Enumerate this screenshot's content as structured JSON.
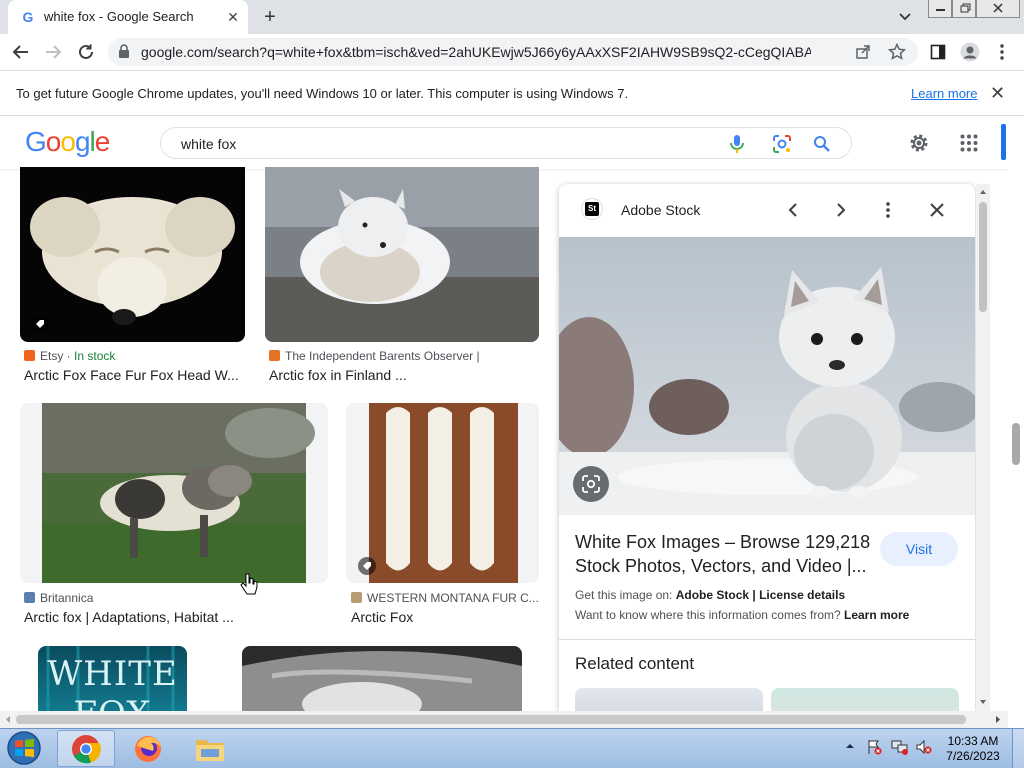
{
  "browser": {
    "tab_title": "white fox - Google Search",
    "new_tab_label": "+",
    "url": "google.com/search?q=white+fox&tbm=isch&ved=2ahUKEwjw5J66y6yAAxXSF2IAHW9SB9sQ2-cCegQIABAA&o..."
  },
  "infobar": {
    "message": "To get future Google Chrome updates, you'll need Windows 10 or later. This computer is using Windows 7.",
    "learn_more": "Learn more",
    "close": "✕"
  },
  "google": {
    "logo_letters": [
      "G",
      "o",
      "o",
      "g",
      "l",
      "e"
    ],
    "logo_colors": [
      "#4285F4",
      "#EA4335",
      "#FBBC05",
      "#4285F4",
      "#34A853",
      "#EA4335"
    ],
    "query": "white fox"
  },
  "results": [
    {
      "source": "Etsy",
      "separator": " · ",
      "badge": "In stock",
      "title": "Arctic Fox Face Fur Fox Head W...",
      "icon_color": "#F1641E"
    },
    {
      "source": "The Independent Barents Observer |",
      "title": "Arctic fox in Finland ...",
      "icon_color": "#E37222"
    },
    {
      "source": "Britannica",
      "title": "Arctic fox | Adaptations, Habitat ...",
      "icon_color": "#5b7fb0"
    },
    {
      "source": "WESTERN MONTANA FUR C...",
      "title": "Arctic Fox",
      "icon_color": "#b79b72"
    },
    {
      "title_art": "WHITE FOX"
    }
  ],
  "panel": {
    "source_logo": "St",
    "source_name": "Adobe Stock",
    "title": "White Fox Images – Browse 129,218 Stock Photos, Vectors, and Video |...",
    "visit": "Visit",
    "get_prefix": "Get this image on: ",
    "get_site": "Adobe Stock",
    "get_sep": " | ",
    "license": "License details",
    "where_text": "Want to know where this information comes from? ",
    "where_link": "Learn more",
    "related": "Related content"
  },
  "taskbar": {
    "time": "10:33 AM",
    "date": "7/26/2023"
  }
}
